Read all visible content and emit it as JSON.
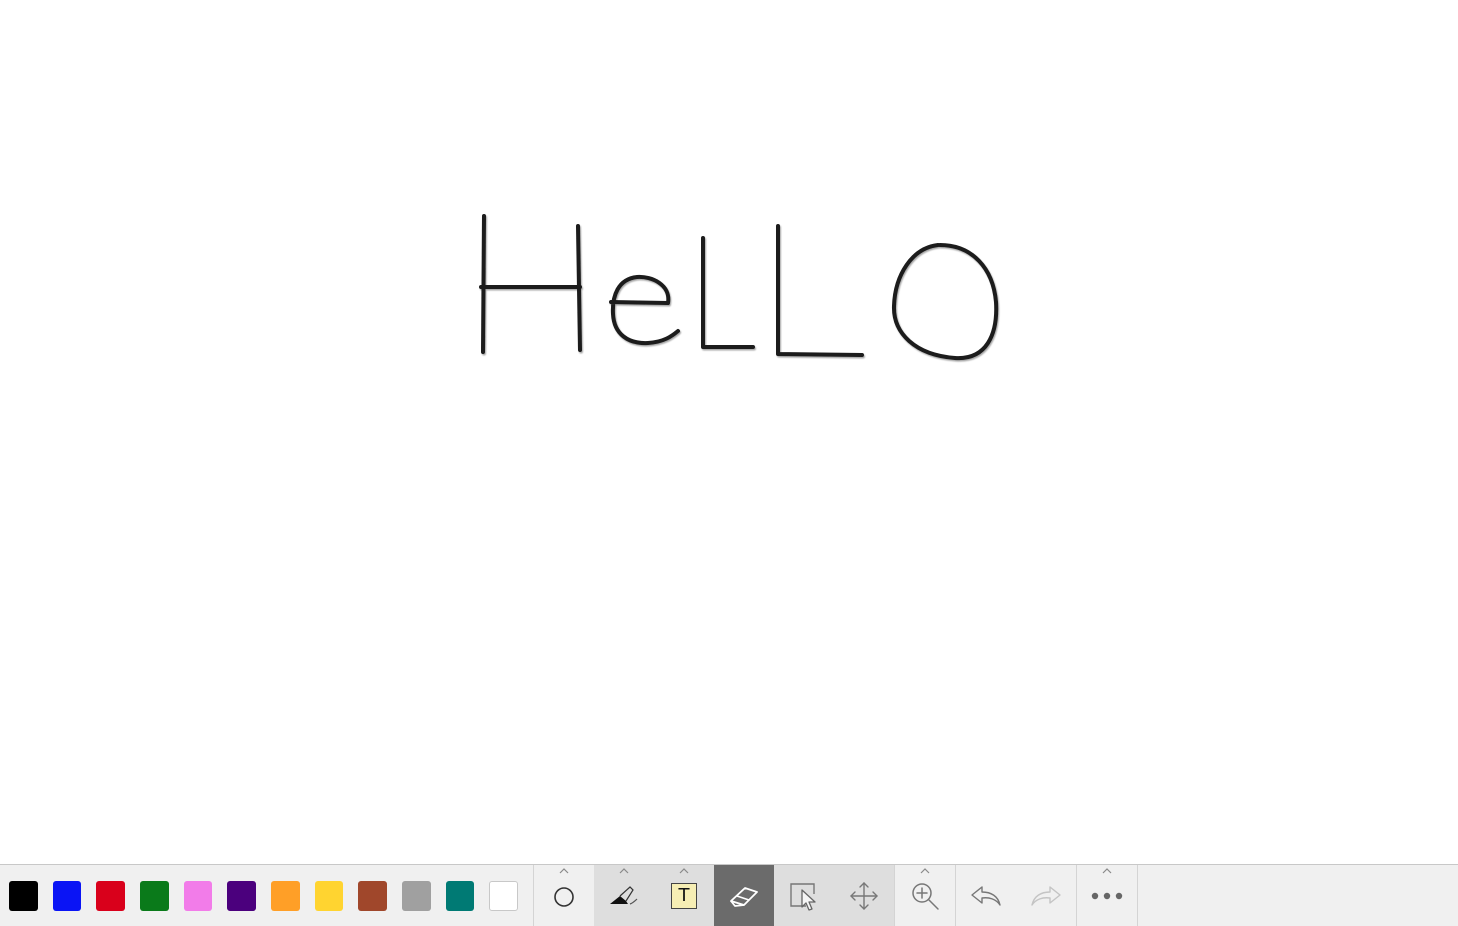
{
  "canvas": {
    "handwriting": "HeLLO",
    "ink_color": "#1a1a1a",
    "underline_color": "#7a7a7a"
  },
  "palette": {
    "colors": [
      {
        "name": "black",
        "hex": "#000000"
      },
      {
        "name": "blue",
        "hex": "#0a14f5"
      },
      {
        "name": "red",
        "hex": "#d9001b"
      },
      {
        "name": "green",
        "hex": "#0a7a1a"
      },
      {
        "name": "pink",
        "hex": "#f27ce9"
      },
      {
        "name": "purple",
        "hex": "#4b007d"
      },
      {
        "name": "orange",
        "hex": "#ff9f27"
      },
      {
        "name": "yellow",
        "hex": "#ffd430"
      },
      {
        "name": "brown",
        "hex": "#a0472b"
      },
      {
        "name": "gray",
        "hex": "#a0a0a0"
      },
      {
        "name": "teal",
        "hex": "#007a74"
      },
      {
        "name": "white",
        "hex": "#ffffff"
      }
    ]
  },
  "tools": {
    "shape": {
      "icon": "circle-icon",
      "has_options": true
    },
    "pen": {
      "icon": "pen-icon",
      "has_options": true
    },
    "text": {
      "icon": "text-box-icon",
      "label": "T",
      "has_options": true
    },
    "eraser": {
      "icon": "eraser-icon",
      "selected": true
    },
    "select": {
      "icon": "select-cursor-icon"
    },
    "pan": {
      "icon": "move-arrows-icon"
    },
    "zoom": {
      "icon": "zoom-in-icon",
      "has_options": true
    },
    "undo": {
      "icon": "undo-icon"
    },
    "redo": {
      "icon": "redo-icon",
      "disabled": true
    },
    "more": {
      "icon": "more-dots-icon",
      "has_options": true
    }
  }
}
